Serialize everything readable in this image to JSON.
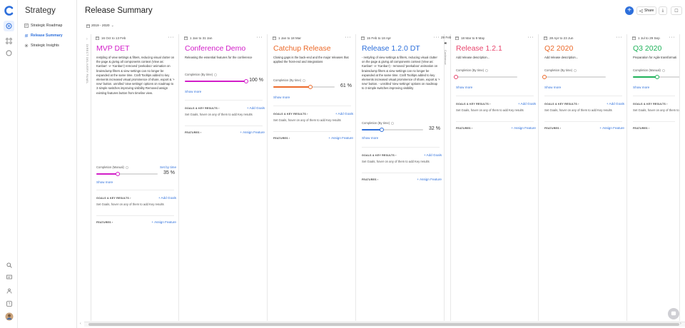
{
  "app": {
    "space_title": "Strategy",
    "page_title": "Release Summary"
  },
  "sidebar": {
    "items": [
      {
        "label": "Strategic Roadmap",
        "icon": "roadmap-icon"
      },
      {
        "label": "Release Summary",
        "icon": "release-icon",
        "active": true
      },
      {
        "label": "Strategic Insights",
        "icon": "insights-icon"
      }
    ]
  },
  "toolbar": {
    "range": "2019 - 2020",
    "share": "Share"
  },
  "collapsed": {
    "label": "DIRECT DELIVERY PANEL"
  },
  "milestone": {
    "date": "29 Feb",
    "label": "Conference"
  },
  "releases": [
    {
      "dates": "16 Oct to 13 Feb",
      "name": "MVP DET",
      "color": "#d21ec8",
      "desc": "restyling of view settings & filters, reducing visual clutter on the page & giving all components context (View as: Kanban' -v- 'Kanban') removed 'peekaboo' animation on brainsdump filters & view settings can no longer be expanded at the same time. Craft Tooltips added to key elements increased visual prominence of share, export & '+ new' button. unrolled 'view settings' options on roadmap to 3 simple switches improving visibility Removed assign existing features button from timeline view.",
      "progress_label": "Completion (Manual)",
      "progress_link": "Set by time",
      "progress": 35,
      "pct_text": "35 %",
      "show_more": "Show more",
      "goals_head": "GOALS & KEY RESULTS",
      "add_goals": "+ Add Goals",
      "goals_text": "Set Goals, hover on any of them to add Key results",
      "features_head": "FEATURES",
      "assign": "+ Assign Feature"
    },
    {
      "dates": "1 Jan to 31 Jan",
      "name": "Conference Demo",
      "color": "#d21ec8",
      "desc": "Releasing the essential features for the conference",
      "progress_label": "Completion (By time)",
      "progress_link": "",
      "progress": 100,
      "pct_text": "100 %",
      "show_more": "Show more",
      "goals_head": "GOALS & KEY RESULTS",
      "add_goals": "+ Add Goals",
      "goals_text": "Set Goals, hover on any of them to add Key results",
      "features_head": "FEATURES",
      "assign": "+ Assign Feature"
    },
    {
      "dates": "1 Jan to 18 Mar",
      "name": "Catchup Release",
      "color": "#ec6a2a",
      "desc": "Closing gaps is the back-end and the major releases that applied the front-end and integrations",
      "progress_label": "Completion (By time)",
      "progress_link": "",
      "progress": 61,
      "pct_text": "61 %",
      "show_more": "Show more",
      "goals_head": "GOALS & KEY RESULTS",
      "add_goals": "+ Add Goals",
      "goals_text": "Set Goals, hover on any of them to add Key results",
      "features_head": "FEATURES",
      "assign": "+ Assign Feature"
    },
    {
      "dates": "15 Feb to 18 Apr",
      "name": "Release 1.2.0 DT",
      "color": "#2d6fdb",
      "desc": "- restyling of view settings & filters, reducing visual clutter on the page & giving all components context (View as: Kanban' -v- 'Kanban') - removed 'peekaboo' animation on brainsdump filters & view settings can no longer be expanded at the same time. Craft Tooltips added to key elements increased visual prominence of share, export & '+ new' button. - unrolled 'view settings' options on roadmap to 3 simple switches improving visibility",
      "progress_label": "Completion (By time)",
      "progress_link": "",
      "progress": 32,
      "pct_text": "32 %",
      "show_more": "Show more",
      "goals_head": "GOALS & KEY RESULTS",
      "add_goals": "+ Add Goals",
      "goals_text": "Set Goals, hover on any of them to add Key results",
      "features_head": "FEATURES",
      "assign": "+ Assign Feature"
    },
    {
      "dates": "18 Mar to 9 May",
      "name": "Release 1.2.1",
      "color": "#e8456d",
      "desc": "Add release description...",
      "progress_label": "Completion (By time)",
      "progress_link": "",
      "progress": 0,
      "pct_text": "",
      "show_more": "Show more",
      "goals_head": "GOALS & KEY RESULTS",
      "add_goals": "+ Add Goals",
      "goals_text": "Set Goals, hover on any of them to add Key results",
      "features_head": "FEATURES",
      "assign": "+ Assign Feature"
    },
    {
      "dates": "28 Apr to 23 Jun",
      "name": "Q2 2020",
      "color": "#ec6a2a",
      "desc": "Add release description...",
      "progress_label": "Completion (By time)",
      "progress_link": "",
      "progress": 0,
      "pct_text": "",
      "show_more": "Show more",
      "goals_head": "GOALS & KEY RESULTS",
      "add_goals": "+ Add Goals",
      "goals_text": "Set Goals, hover on any of them to add Key results",
      "features_head": "FEATURES",
      "assign": "+ Assign Feature"
    },
    {
      "dates": "1 Jul to 29 Sep",
      "name": "Q3 2020",
      "color": "#1fb25a",
      "desc": "Preparation for Agile transformati",
      "progress_label": "Completion (Manual)",
      "progress_link": "",
      "progress": 40,
      "pct_text": "",
      "show_more": "Show more",
      "goals_head": "GOALS & KEY RESULTS",
      "add_goals": "+",
      "goals_text": "Set Goals, hover on any of them to add Key results",
      "features_head": "FEATURES",
      "assign": "+"
    }
  ]
}
